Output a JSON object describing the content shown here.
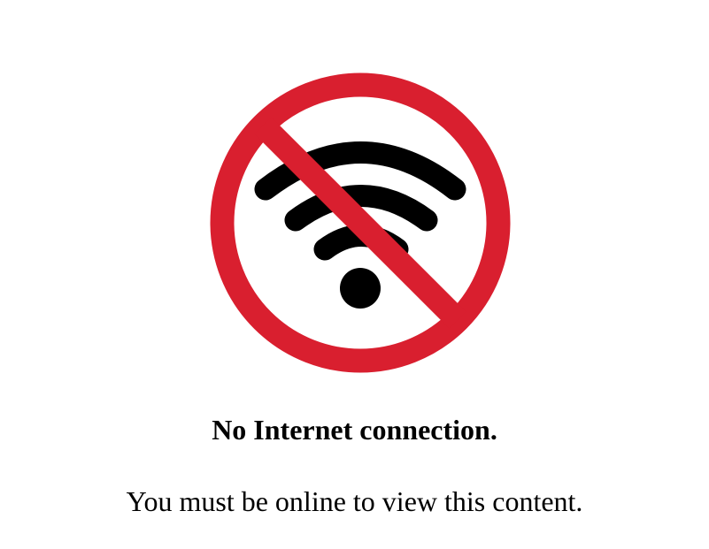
{
  "offline_notice": {
    "icon": "no-wifi-icon",
    "icon_colors": {
      "prohibition": "#d91f2f",
      "wifi": "#000000"
    },
    "title": "No Internet connection.",
    "message": "You must be online to view this content."
  }
}
